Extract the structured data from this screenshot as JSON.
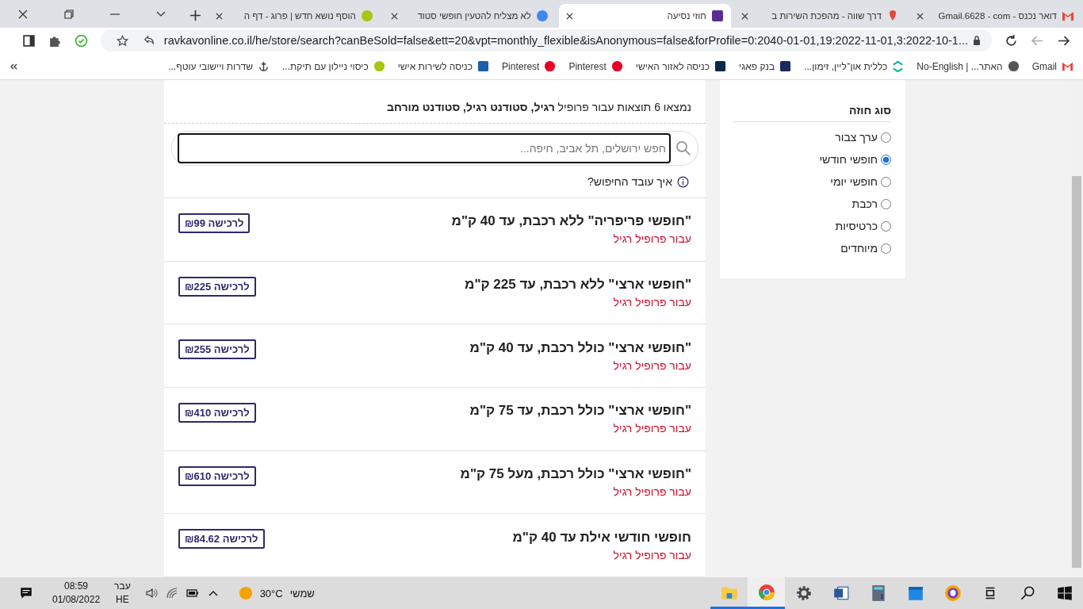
{
  "browser": {
    "tabs": [
      {
        "title": "דואר נכנס - Gmail.6628 - com",
        "kind": "m",
        "selected": false
      },
      {
        "title": "דרך שווה - מהפכת השירות ב",
        "kind": "pin",
        "selected": false
      },
      {
        "title": "חוזי נסיעה",
        "kind": "app",
        "selected": true
      },
      {
        "title": "לא מצליח להטעין חופשי סטוד",
        "kind": "g",
        "selected": false
      },
      {
        "title": "הוסף נושא חדש | פרוג - דף ה",
        "kind": "cloud",
        "selected": false
      }
    ],
    "url": "ravkavonline.co.il/he/store/search?canBeSold=false&ett=20&vpt=monthly_flexible&isAnonymous=false&forProfile=0:2040-01-01,19:2022-11-01,3:2022-10-1...",
    "bookmarks": [
      {
        "label": "Gmail",
        "kind": "m"
      },
      {
        "label": "האתר... | No-English",
        "kind": "globe"
      },
      {
        "label": "כללית און־ליין, זימון...",
        "kind": "chevrons"
      },
      {
        "label": "בנק פאגי",
        "kind": "bank"
      },
      {
        "label": "כניסה לאזור האישי",
        "kind": "msquare"
      },
      {
        "label": "Pinterest",
        "kind": "p"
      },
      {
        "label": "Pinterest",
        "kind": "p"
      },
      {
        "label": "כניסה לשירות אישי",
        "kind": "grid"
      },
      {
        "label": "כיסוי ניילון עם תיקת...",
        "kind": "cloud"
      },
      {
        "label": "שדרות ויישובי עוטף...",
        "kind": "anchor"
      }
    ]
  },
  "page": {
    "summary": "נמצאו 6 תוצאות עבור פרופיל **רגיל, סטודנט רגיל, סטודנט מורחב**",
    "search": {
      "placeholder": "חפש ירושלים, תל אביב, חיפה..."
    },
    "help_link": "איך עובד החיפוש?",
    "results": [
      {
        "title": "\"חופשי פריפריה\" ללא רכבת, עד 40 ק\"מ",
        "profile": "עבור פרופיל רגיל",
        "buy": "לרכישה ₪99"
      },
      {
        "title": "\"חופשי ארצי\" ללא רכבת, עד 225 ק\"מ",
        "profile": "עבור פרופיל רגיל",
        "buy": "לרכישה ₪225"
      },
      {
        "title": "\"חופשי ארצי\" כולל רכבת, עד 40 ק\"מ",
        "profile": "עבור פרופיל רגיל",
        "buy": "לרכישה ₪255"
      },
      {
        "title": "\"חופשי ארצי\" כולל רכבת, עד 75 ק\"מ",
        "profile": "עבור פרופיל רגיל",
        "buy": "לרכישה ₪410"
      },
      {
        "title": "\"חופשי ארצי\" כולל רכבת, מעל 75 ק\"מ",
        "profile": "עבור פרופיל רגיל",
        "buy": "לרכישה ₪610"
      },
      {
        "title": "חופשי חודשי אילת עד 40 ק\"מ",
        "profile": "עבור פרופיל רגיל",
        "buy": "לרכישה ₪84.62"
      }
    ]
  },
  "filters": {
    "heading": "סוג חוזה",
    "options": [
      {
        "label": "ערך צבור",
        "selected": false
      },
      {
        "label": "חופשי חודשי",
        "selected": true
      },
      {
        "label": "חופשי יומי",
        "selected": false
      },
      {
        "label": "רכבת",
        "selected": false
      },
      {
        "label": "כרטיסיות",
        "selected": false
      },
      {
        "label": "מיוחדים",
        "selected": false
      }
    ]
  },
  "taskbar": {
    "time": "08:59",
    "date": "01/08/2022",
    "language": [
      "עבר",
      "HE"
    ],
    "temperature": "30°C",
    "weather": "שמשי"
  }
}
